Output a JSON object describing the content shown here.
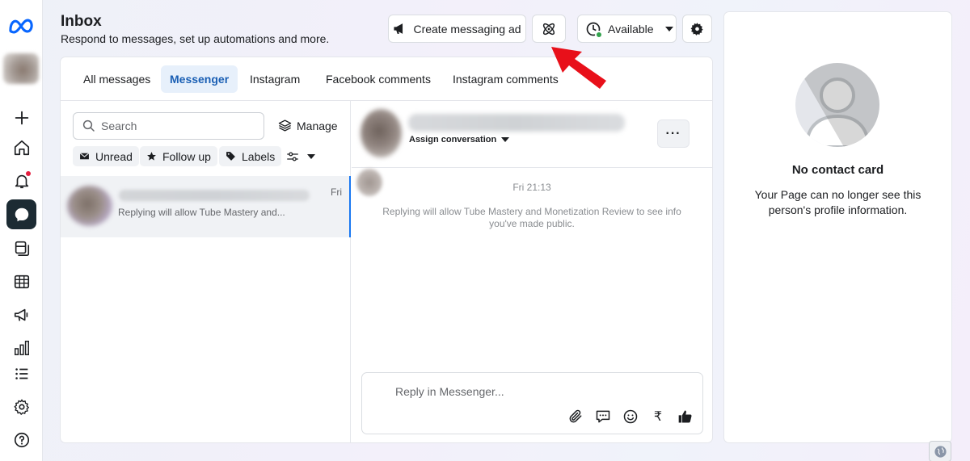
{
  "header": {
    "title": "Inbox",
    "subtitle": "Respond to messages, set up automations and more.",
    "create_ad_label": "Create messaging ad",
    "status_label": "Available"
  },
  "sidebar": {
    "items": [
      {
        "name": "create",
        "icon": "plus-icon"
      },
      {
        "name": "home",
        "icon": "home-icon"
      },
      {
        "name": "notifications",
        "icon": "bell-icon"
      },
      {
        "name": "inbox",
        "icon": "message-icon",
        "active": true
      },
      {
        "name": "content",
        "icon": "content-icon"
      },
      {
        "name": "planner",
        "icon": "table-icon"
      },
      {
        "name": "ads",
        "icon": "megaphone-icon"
      },
      {
        "name": "insights",
        "icon": "bar-chart-icon"
      },
      {
        "name": "menu",
        "icon": "list-icon"
      },
      {
        "name": "settings",
        "icon": "gear-icon"
      },
      {
        "name": "help",
        "icon": "help-icon"
      }
    ]
  },
  "tabs": [
    {
      "label": "All messages"
    },
    {
      "label": "Messenger",
      "active": true
    },
    {
      "label": "Instagram"
    },
    {
      "label": "Facebook comments"
    },
    {
      "label": "Instagram comments"
    }
  ],
  "list": {
    "search_placeholder": "Search",
    "manage_label": "Manage",
    "filters": {
      "unread": "Unread",
      "follow_up": "Follow up",
      "labels": "Labels"
    },
    "conversations": [
      {
        "time": "Fri",
        "snippet": "Replying will allow Tube Mastery and..."
      }
    ]
  },
  "chat": {
    "assign_label": "Assign conversation",
    "more_label": "···",
    "message_time": "Fri 21:13",
    "message_note": "Replying will allow Tube Mastery and Monetization Review to see info you've made public.",
    "composer_placeholder": "Reply in Messenger...",
    "currency_symbol": "₹"
  },
  "contact_card": {
    "title": "No contact card",
    "text": "Your Page can no longer see this person's profile information."
  },
  "colors": {
    "accent": "#1877f2",
    "active_tab_bg": "#e7f0fb",
    "active_rail": "#1c2b33",
    "annotation_arrow": "#e8101a",
    "status_green": "#31a24c"
  }
}
